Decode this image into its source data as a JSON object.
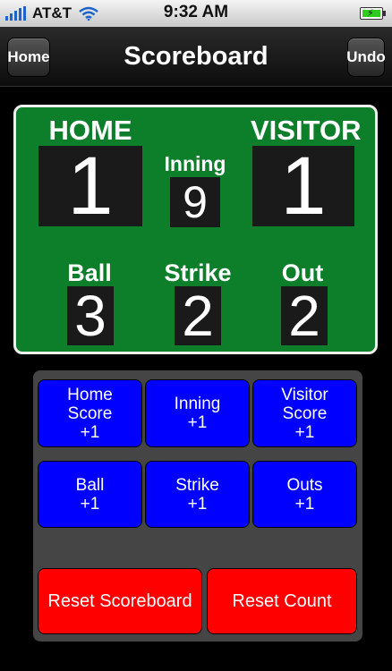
{
  "status_bar": {
    "carrier": "AT&T",
    "time": "9:32 AM",
    "icons": [
      "signal-bars-icon",
      "wifi-icon",
      "battery-charging-icon"
    ]
  },
  "nav": {
    "home_label": "Home",
    "title": "Scoreboard",
    "undo_label": "Undo"
  },
  "scoreboard": {
    "home_label": "HOME",
    "home_score": "1",
    "visitor_label": "VISITOR",
    "visitor_score": "1",
    "inning_label": "Inning",
    "inning_value": "9",
    "ball_label": "Ball",
    "ball_value": "3",
    "strike_label": "Strike",
    "strike_value": "2",
    "out_label": "Out",
    "out_value": "2"
  },
  "controls": {
    "home_score_btn": "Home\nScore\n+1",
    "inning_btn": "Inning\n+1",
    "visitor_score_btn": "Visitor\nScore\n+1",
    "ball_btn": "Ball\n+1",
    "strike_btn": "Strike\n+1",
    "outs_btn": "Outs\n+1",
    "reset_scoreboard": "Reset Scoreboard",
    "reset_count": "Reset Count"
  },
  "colors": {
    "board_green": "#0d7f2b",
    "button_blue": "#0000ff",
    "button_red": "#ff0000",
    "panel_gray": "#454545"
  }
}
